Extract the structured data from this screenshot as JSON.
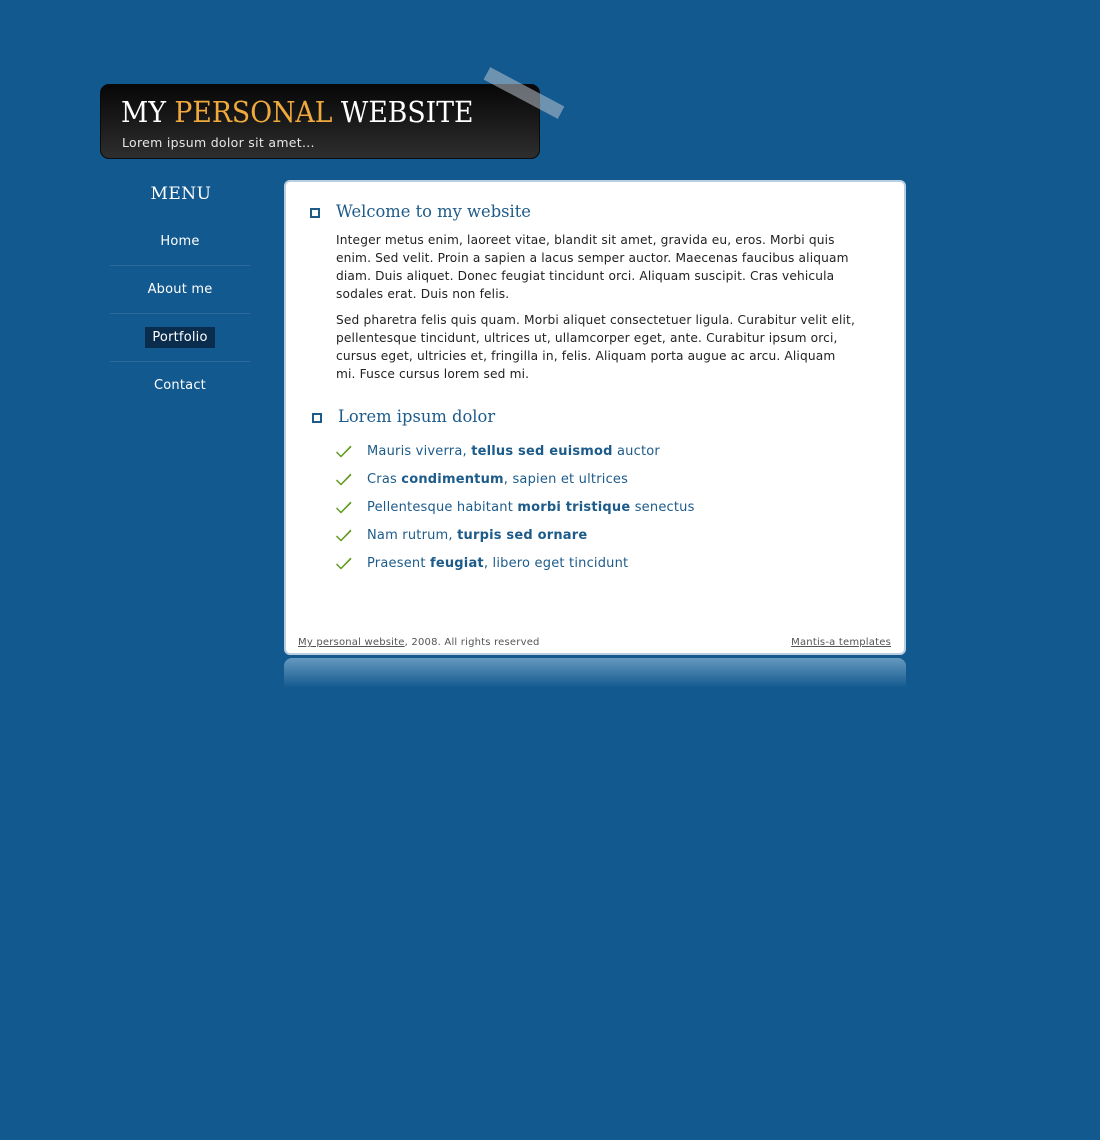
{
  "header": {
    "title_part1": "MY",
    "title_accent": "PERSONAL",
    "title_part2": "WEBSITE",
    "tagline": "Lorem ipsum dolor sit amet..."
  },
  "menu": {
    "heading": "MENU",
    "items": [
      {
        "label": "Home",
        "active": false
      },
      {
        "label": "About me",
        "active": false
      },
      {
        "label": "Portfolio",
        "active": true
      },
      {
        "label": "Contact",
        "active": false
      }
    ]
  },
  "content": {
    "section1": {
      "heading": "Welcome to my website",
      "paragraphs": [
        "Integer metus enim, laoreet vitae, blandit sit amet, gravida eu, eros. Morbi quis enim. Sed velit. Proin a sapien a lacus semper auctor. Maecenas faucibus aliquam diam. Duis aliquet. Donec feugiat tincidunt orci. Aliquam suscipit. Cras vehicula sodales erat. Duis non felis.",
        "Sed pharetra felis quis quam. Morbi aliquet consectetuer ligula. Curabitur velit elit, pellentesque tincidunt, ultrices ut, ullamcorper eget, ante. Curabitur ipsum orci, cursus eget, ultricies et, fringilla in, felis. Aliquam porta augue ac arcu. Aliquam mi. Fusce cursus lorem sed mi."
      ]
    },
    "section2": {
      "heading": "Lorem ipsum dolor",
      "items": [
        {
          "before": "Mauris viverra, ",
          "bold": "tellus sed euismod",
          "after": " auctor"
        },
        {
          "before": "Cras ",
          "bold": "condimentum",
          "after": ", sapien et ultrices"
        },
        {
          "before": "Pellentesque habitant ",
          "bold": "morbi tristique",
          "after": " senectus"
        },
        {
          "before": "Nam rutrum, ",
          "bold": "turpis sed ornare",
          "after": ""
        },
        {
          "before": "Praesent ",
          "bold": "feugiat",
          "after": ", libero eget tincidunt"
        }
      ]
    }
  },
  "footer": {
    "site_link": "My personal website",
    "copyright": ", 2008. All rights reserved",
    "templates_link": "Mantis-a templates"
  },
  "colors": {
    "background": "#12598f",
    "accent": "#f0a93d",
    "heading": "#1d5b8a",
    "check": "#5e9a1c",
    "active_menu": "#0b2d4d"
  },
  "icons": {
    "section_bullet": "square-bullet-icon",
    "list_bullet": "checkmark-icon"
  }
}
